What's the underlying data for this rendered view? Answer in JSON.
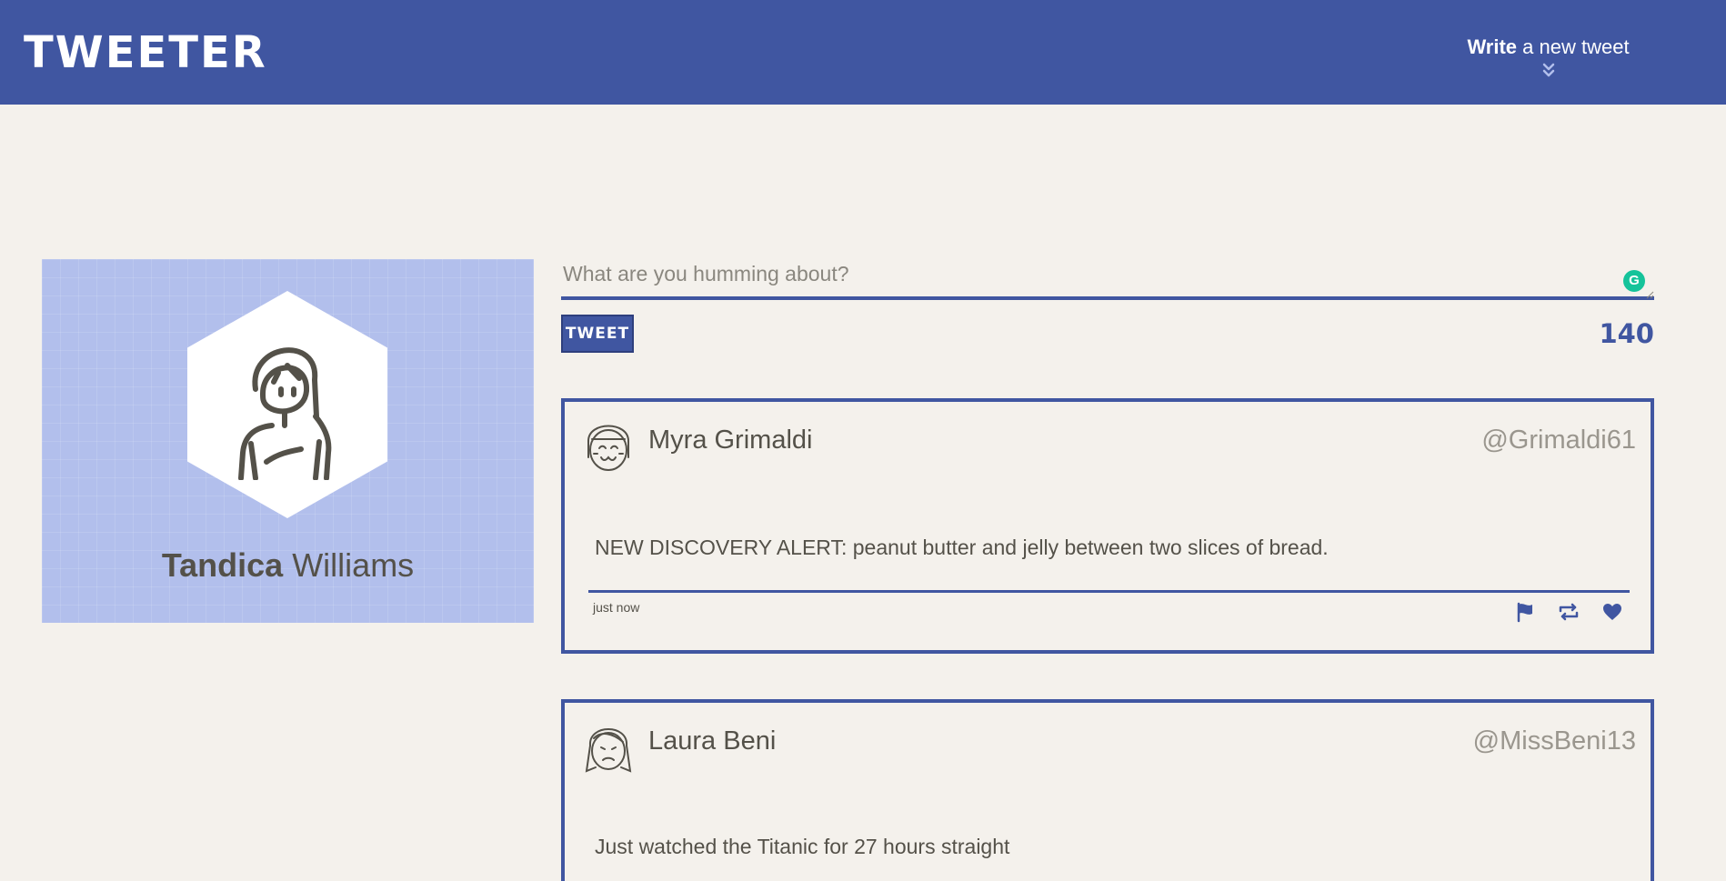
{
  "header": {
    "logo": "TWEETER",
    "compose_bold": "Write",
    "compose_rest": " a new tweet",
    "compose_icon": "double-chevron-down-icon"
  },
  "profile": {
    "first_name": "Tandica",
    "last_name": "Williams",
    "avatar_icon": "user-avatar-icon"
  },
  "compose": {
    "placeholder": "What are you humming about?",
    "button_label": "TWEET",
    "counter": "140",
    "grammar_badge": "G"
  },
  "tweets": [
    {
      "name": "Myra Grimaldi",
      "handle": "@Grimaldi61",
      "content": "NEW DISCOVERY ALERT: peanut butter and jelly between two slices of bread.",
      "time": "just now",
      "actions": [
        "flag-icon",
        "retweet-icon",
        "heart-icon"
      ]
    },
    {
      "name": "Laura Beni",
      "handle": "@MissBeni13",
      "content": "Just watched the Titanic for 27 hours straight"
    }
  ],
  "colors": {
    "primary": "#4056a1",
    "background": "#f4f1ec",
    "profile_bg": "#b2bfec",
    "text": "#545149",
    "muted": "#9a968e"
  }
}
